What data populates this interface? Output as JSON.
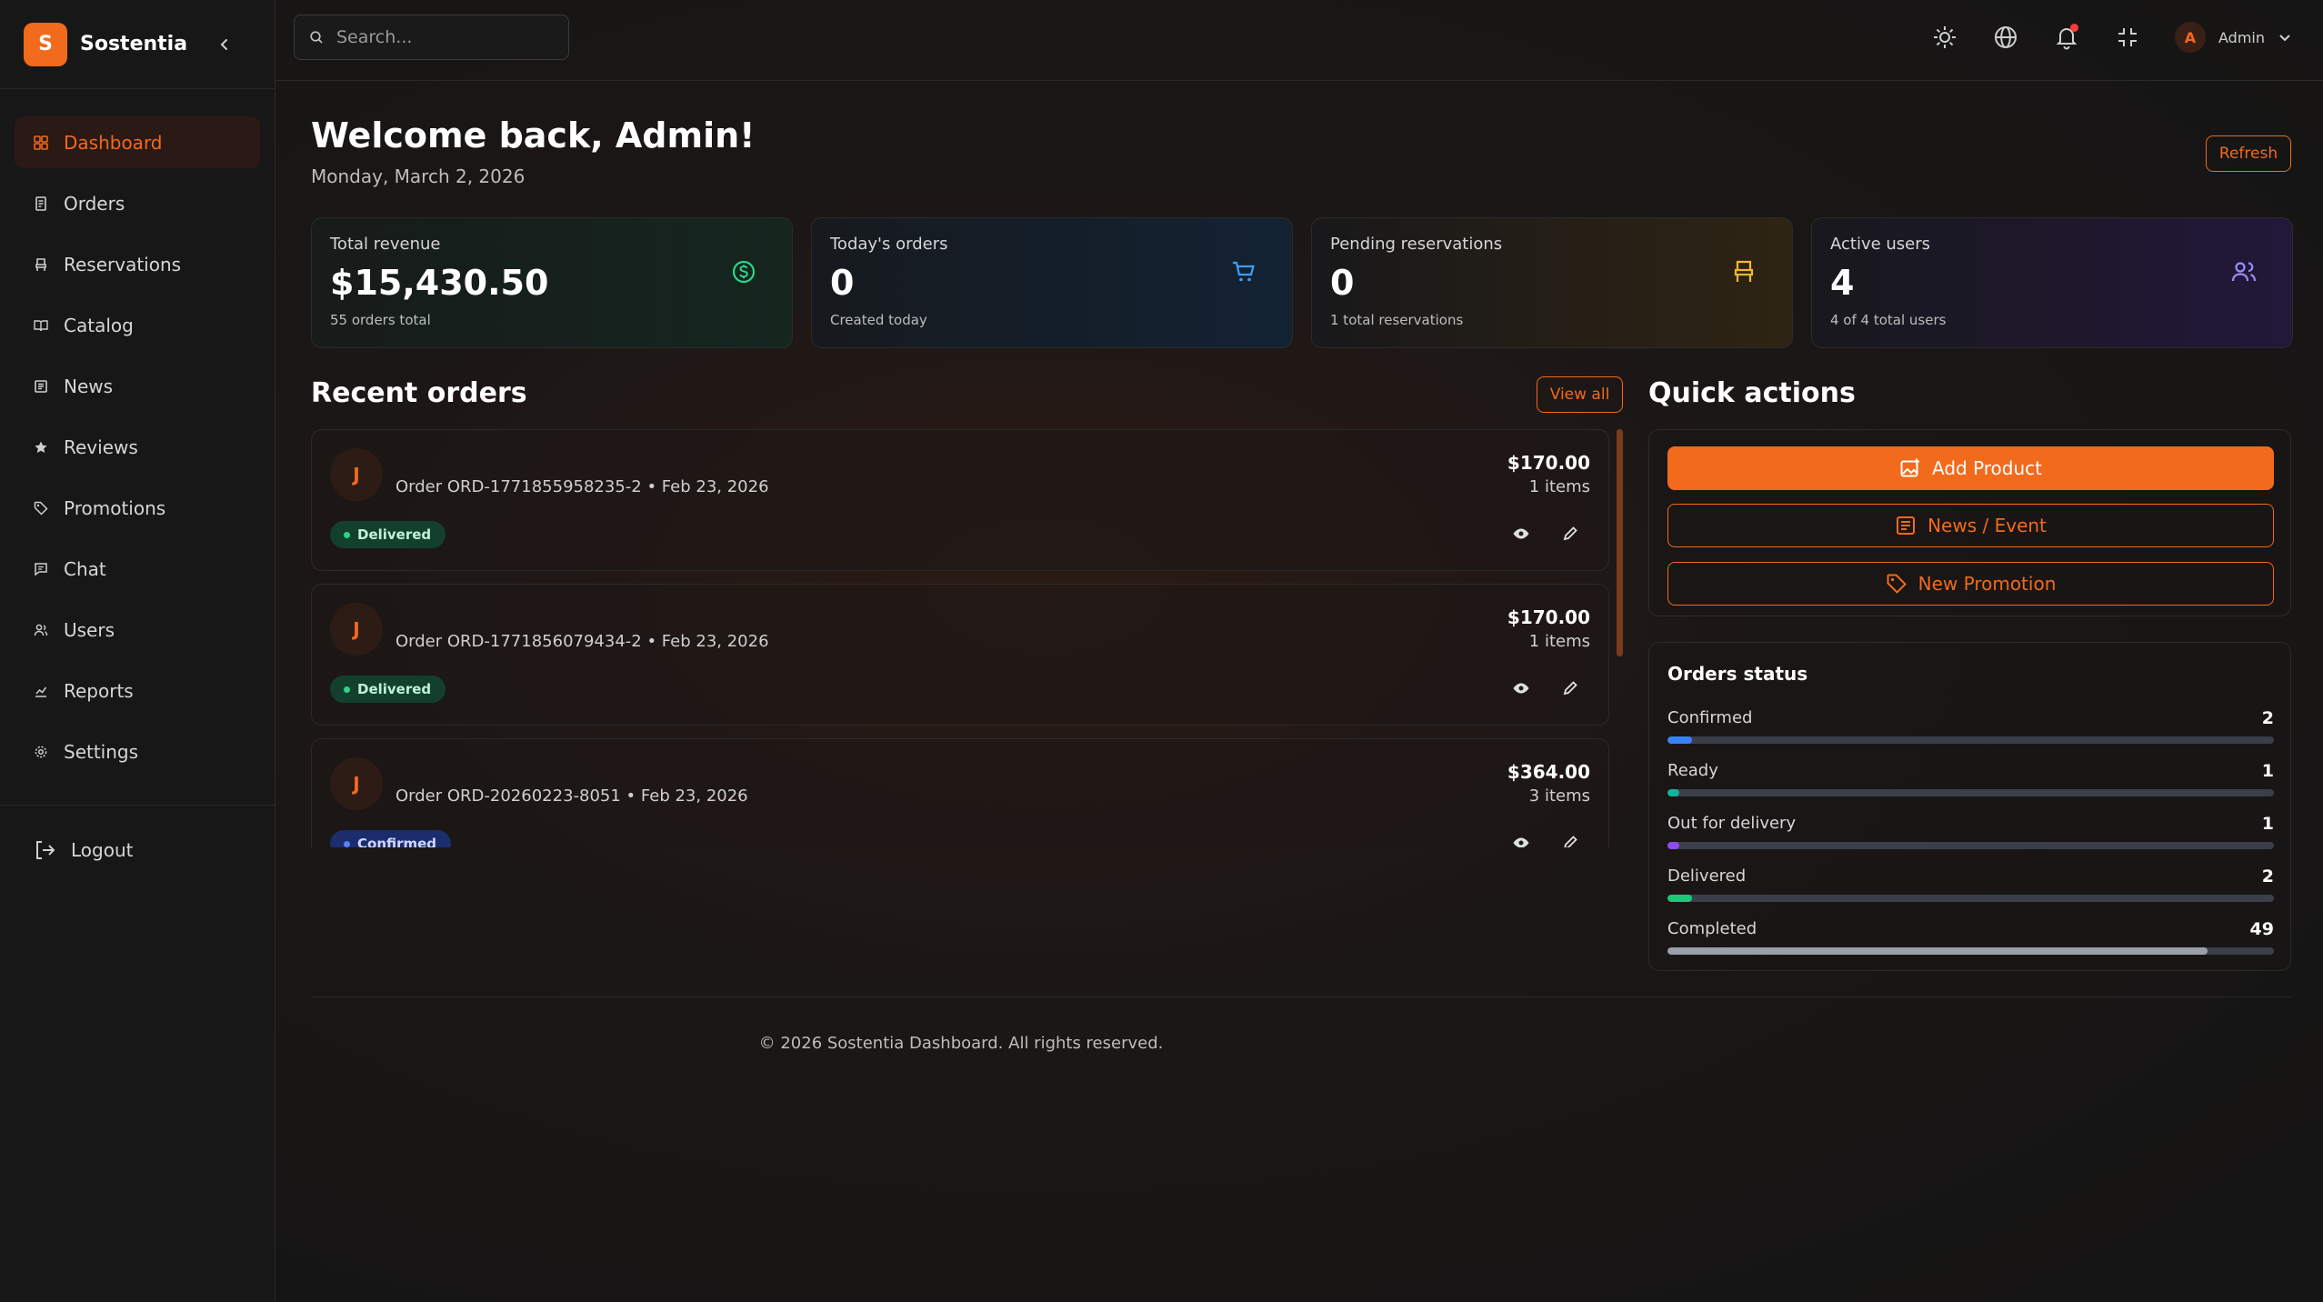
{
  "brand": {
    "logo_letter": "S",
    "name": "Sostentia"
  },
  "sidebar": {
    "items": [
      {
        "label": "Dashboard",
        "icon": "grid-icon",
        "active": true
      },
      {
        "label": "Orders",
        "icon": "receipt-icon"
      },
      {
        "label": "Reservations",
        "icon": "chair-icon"
      },
      {
        "label": "Catalog",
        "icon": "book-icon"
      },
      {
        "label": "News",
        "icon": "newspaper-icon"
      },
      {
        "label": "Reviews",
        "icon": "star-icon"
      },
      {
        "label": "Promotions",
        "icon": "tag-icon"
      },
      {
        "label": "Chat",
        "icon": "chat-icon"
      },
      {
        "label": "Users",
        "icon": "users-icon"
      },
      {
        "label": "Reports",
        "icon": "chart-icon"
      },
      {
        "label": "Settings",
        "icon": "gear-icon"
      }
    ],
    "logout_label": "Logout"
  },
  "topbar": {
    "search_placeholder": "Search...",
    "user_initial": "A",
    "user_name": "Admin"
  },
  "header": {
    "welcome": "Welcome back, Admin!",
    "date": "Monday, March 2, 2026",
    "refresh_label": "Refresh"
  },
  "stats": [
    {
      "label": "Total revenue",
      "value": "$15,430.50",
      "sub": "55 orders total",
      "icon": "dollar-icon",
      "color": "#2ed38a"
    },
    {
      "label": "Today's orders",
      "value": "0",
      "sub": "Created today",
      "icon": "cart-icon",
      "color": "#3aa0ff"
    },
    {
      "label": "Pending reservations",
      "value": "0",
      "sub": "1 total reservations",
      "icon": "chair-icon",
      "color": "#f5b82e"
    },
    {
      "label": "Active users",
      "value": "4",
      "sub": "4 of 4 total users",
      "icon": "users-icon",
      "color": "#9a8cff"
    }
  ],
  "recent_orders": {
    "title": "Recent orders",
    "view_all_label": "View all",
    "items": [
      {
        "initial": "J",
        "text": "Order ORD-1771855958235-2 • Feb 23, 2026",
        "amount": "$170.00",
        "items": "1 items",
        "status": "Delivered",
        "status_key": "delivered"
      },
      {
        "initial": "J",
        "text": "Order ORD-1771856079434-2 • Feb 23, 2026",
        "amount": "$170.00",
        "items": "1 items",
        "status": "Delivered",
        "status_key": "delivered"
      },
      {
        "initial": "J",
        "text": "Order ORD-20260223-8051 • Feb 23, 2026",
        "amount": "$364.00",
        "items": "3 items",
        "status": "Confirmed",
        "status_key": "confirmed"
      }
    ]
  },
  "quick_actions": {
    "title": "Quick actions",
    "add_product": "Add Product",
    "news_event": "News / Event",
    "new_promotion": "New Promotion"
  },
  "orders_status": {
    "title": "Orders status",
    "rows": [
      {
        "label": "Confirmed",
        "count": "2",
        "fraction": 0.04,
        "color": "#3a82f7"
      },
      {
        "label": "Ready",
        "count": "1",
        "fraction": 0.02,
        "color": "#12b39a"
      },
      {
        "label": "Out for delivery",
        "count": "1",
        "fraction": 0.02,
        "color": "#8e4cf0"
      },
      {
        "label": "Delivered",
        "count": "2",
        "fraction": 0.04,
        "color": "#22c47a"
      },
      {
        "label": "Completed",
        "count": "49",
        "fraction": 0.89,
        "color": "#9aa0ab"
      }
    ]
  },
  "footer": {
    "text": "© 2026 Sostentia Dashboard. All rights reserved."
  }
}
